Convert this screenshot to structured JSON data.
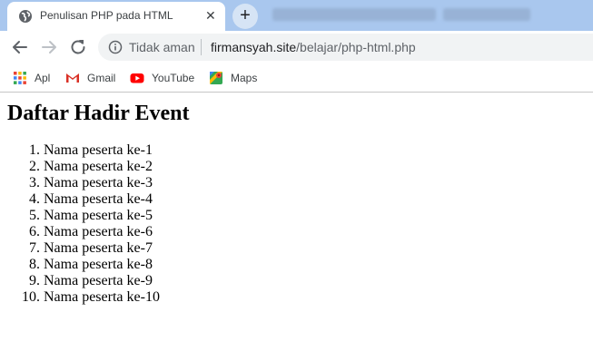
{
  "tab": {
    "title": "Penulisan PHP pada HTML",
    "close_glyph": "✕",
    "favicon": "globe-icon"
  },
  "new_tab_glyph": "+",
  "toolbar": {
    "security_label": "Tidak aman",
    "url_host": "firmansyah.site",
    "url_path": "/belajar/php-html.php"
  },
  "bookmarks": [
    {
      "label": "Apl",
      "icon": "apps-grid-icon"
    },
    {
      "label": "Gmail",
      "icon": "gmail-icon"
    },
    {
      "label": "YouTube",
      "icon": "youtube-icon"
    },
    {
      "label": "Maps",
      "icon": "maps-icon"
    }
  ],
  "page": {
    "heading": "Daftar Hadir Event",
    "participants": [
      "Nama peserta ke-1",
      "Nama peserta ke-2",
      "Nama peserta ke-3",
      "Nama peserta ke-4",
      "Nama peserta ke-5",
      "Nama peserta ke-6",
      "Nama peserta ke-7",
      "Nama peserta ke-8",
      "Nama peserta ke-9",
      "Nama peserta ke-10"
    ]
  },
  "colors": {
    "tabstrip": "#a9c7ee",
    "omnibox": "#f1f3f4",
    "youtube_red": "#ff0000",
    "gmail_red": "#d93025"
  }
}
